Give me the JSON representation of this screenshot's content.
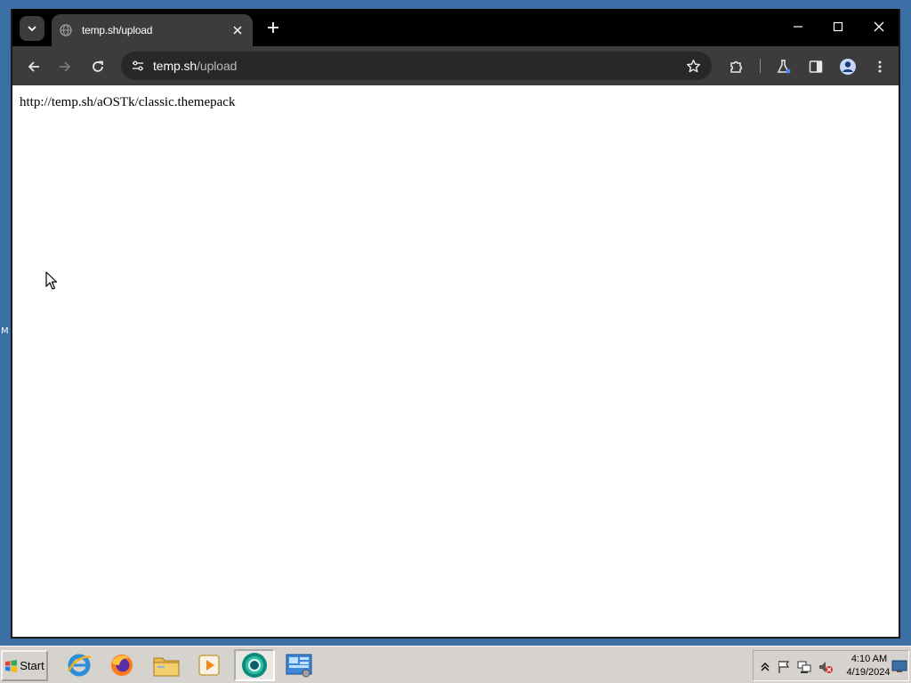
{
  "desktop": {
    "edge_label": "M"
  },
  "browser": {
    "tab": {
      "title": "temp.sh/upload"
    },
    "address": {
      "host": "temp.sh",
      "path": "/upload"
    },
    "page": {
      "body_text": "http://temp.sh/aOSTk/classic.themepack"
    }
  },
  "taskbar": {
    "start_label": "Start",
    "pinned": [
      {
        "name": "internet-explorer-icon"
      },
      {
        "name": "firefox-icon"
      },
      {
        "name": "file-explorer-icon"
      },
      {
        "name": "media-player-icon"
      },
      {
        "name": "chrome-icon",
        "active": true
      },
      {
        "name": "control-panel-icon"
      }
    ],
    "clock": {
      "time": "4:10 AM",
      "date": "4/19/2024"
    }
  },
  "colors": {
    "desktop": "#3a6ea5",
    "titlebar": "#000000",
    "toolbar": "#3c3c3c",
    "omnibox": "#282828",
    "taskbar": "#d6d3ce"
  }
}
